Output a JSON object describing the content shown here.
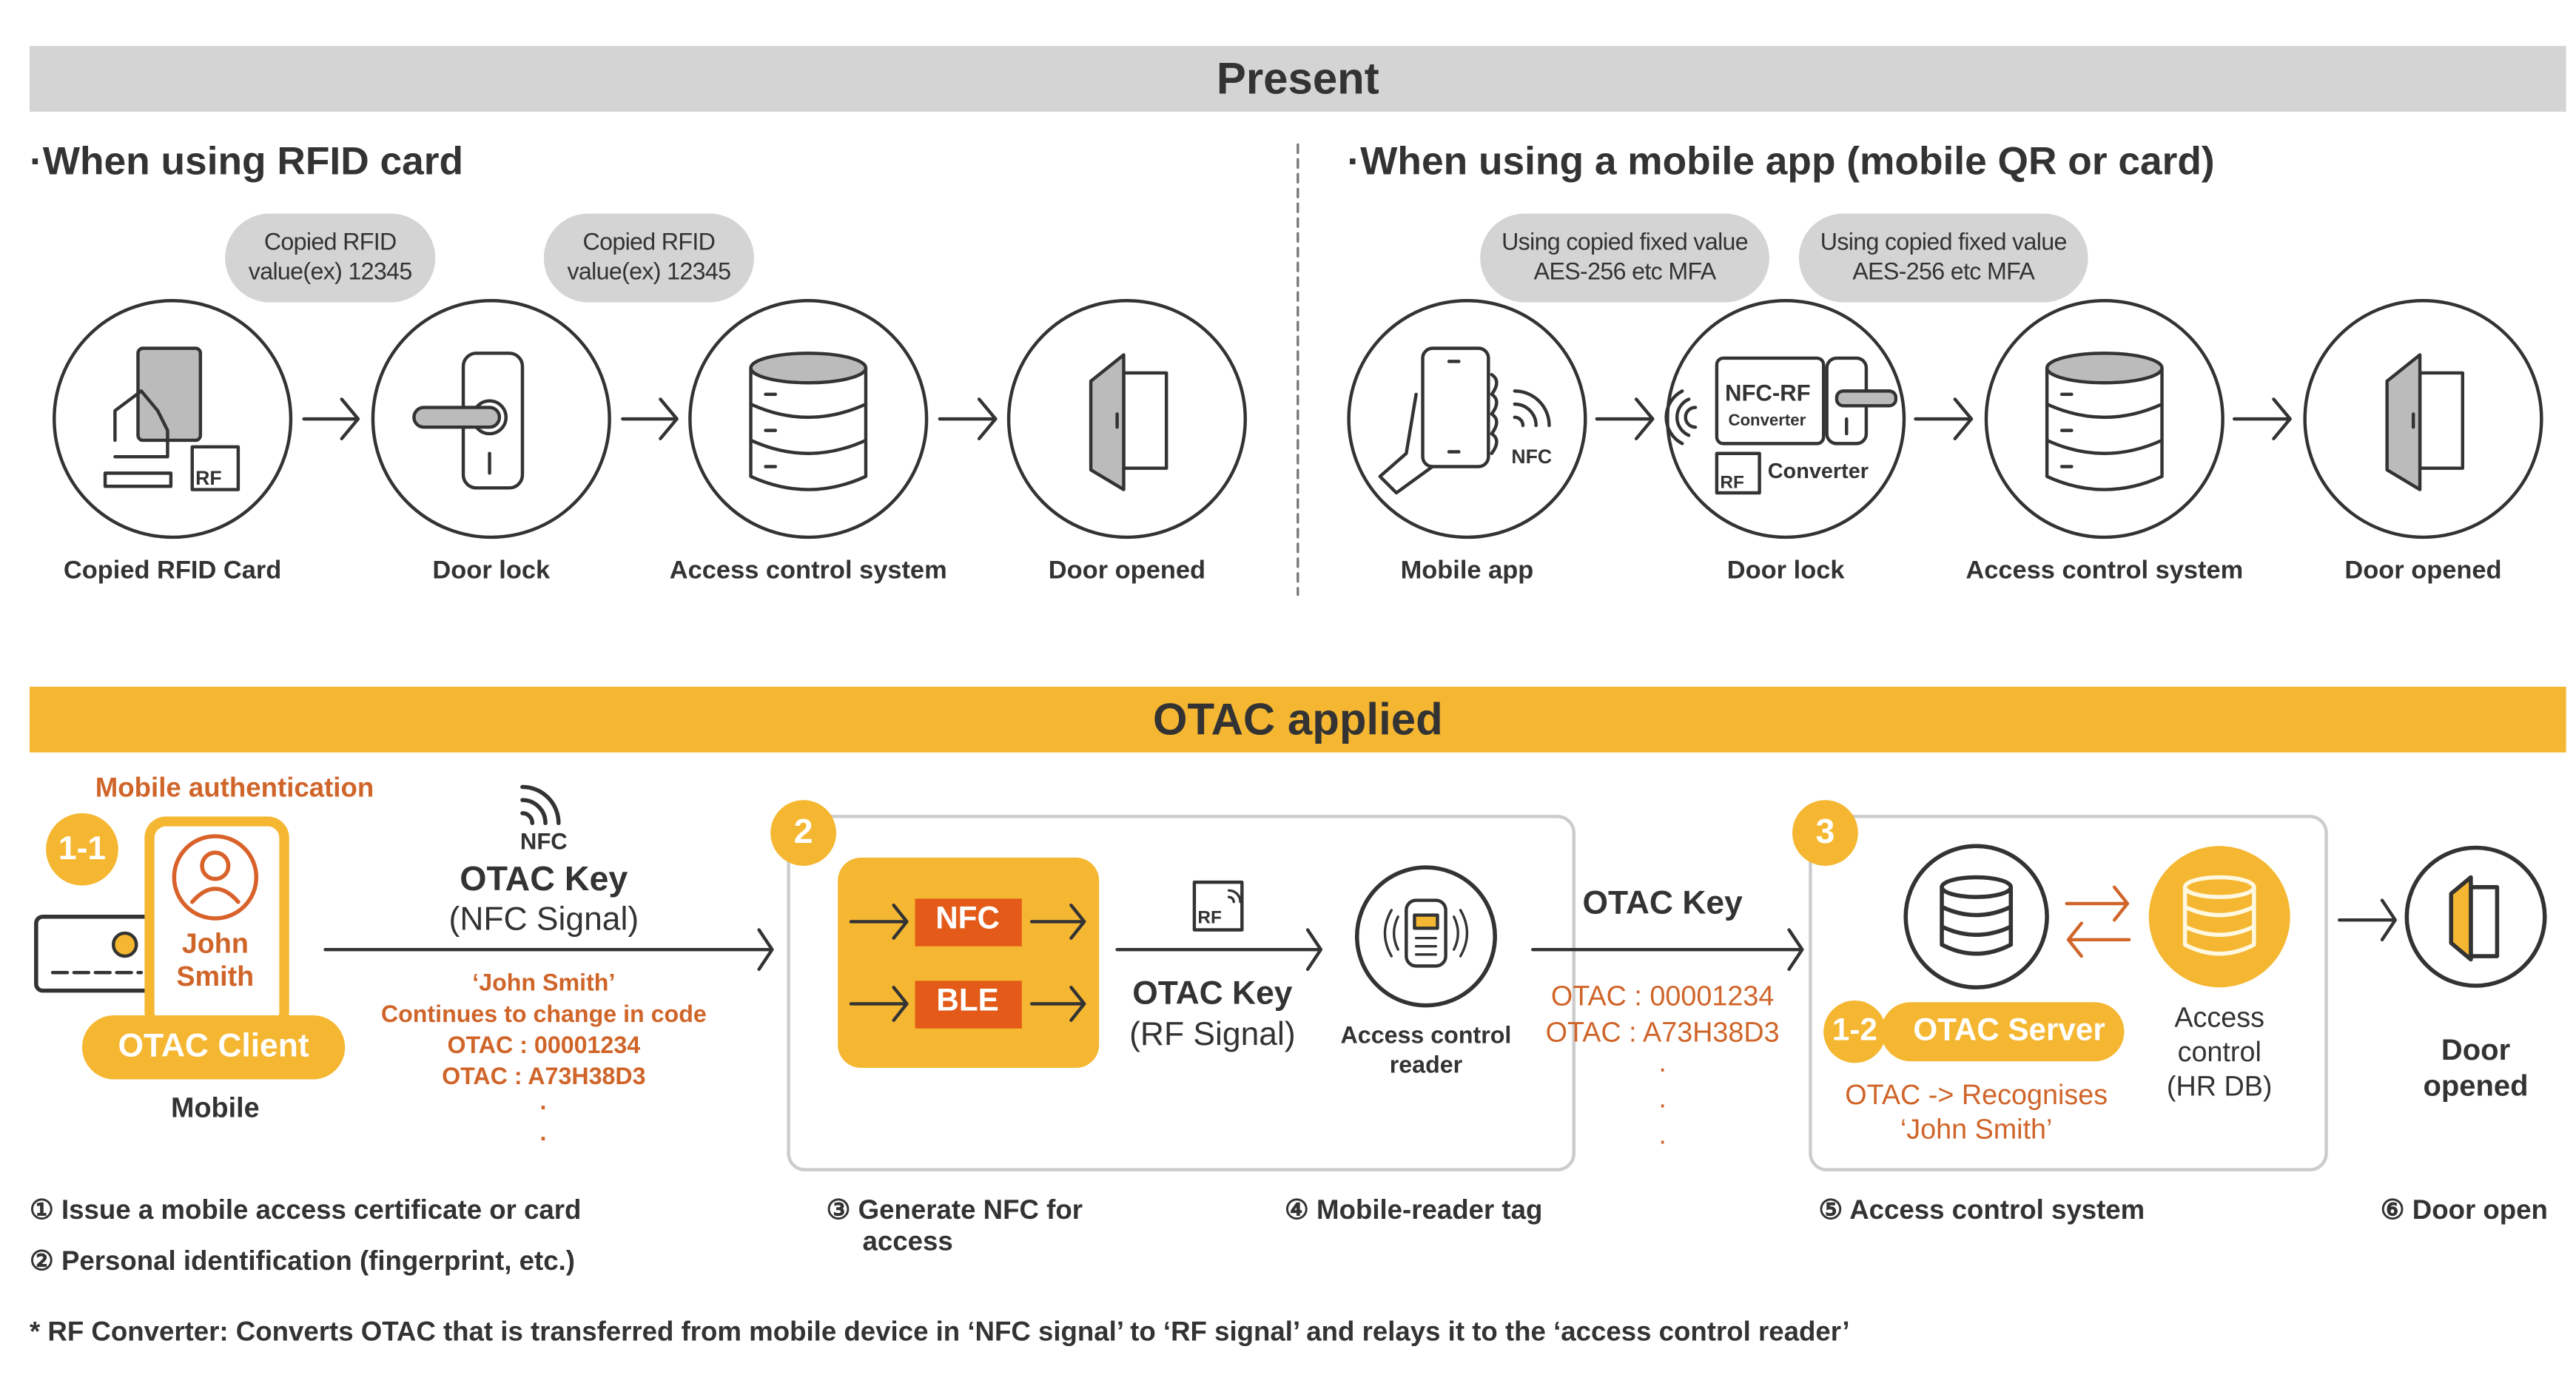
{
  "colors": {
    "accent": "#f5b731",
    "orange_text": "#d0652a",
    "tag_red": "#e35a19",
    "present_bar": "#d4d4d4",
    "ink": "#333333"
  },
  "present": {
    "title": "Present",
    "rfid": {
      "heading": "·When using RFID card",
      "bubbles": [
        "Copied RFID",
        "value(ex) 12345",
        "Copied RFID",
        "value(ex) 12345"
      ],
      "steps": [
        {
          "label": "Copied RFID Card",
          "icon": "rfid-card-hand-icon",
          "tag": "RF"
        },
        {
          "label": "Door lock",
          "icon": "door-lock-icon"
        },
        {
          "label": "Access control system",
          "icon": "database-icon"
        },
        {
          "label": "Door opened",
          "icon": "open-door-icon"
        }
      ]
    },
    "mobile": {
      "heading": "·When using a mobile app (mobile QR or card)",
      "bubbles": [
        "Using copied fixed value",
        "AES-256 etc MFA",
        "Using copied fixed value",
        "AES-256 etc MFA"
      ],
      "steps": [
        {
          "label": "Mobile app",
          "icon": "phone-hand-nfc-icon",
          "tag": "NFC"
        },
        {
          "label": "Door lock",
          "icon": "nfc-rf-converter-lock-icon",
          "tag1": "NFC-RF",
          "tag2": "Converter",
          "rf": "RF",
          "tag3": "Converter"
        },
        {
          "label": "Access control system",
          "icon": "database-icon"
        },
        {
          "label": "Door opened",
          "icon": "open-door-icon"
        }
      ]
    }
  },
  "otac": {
    "title": "OTAC applied",
    "mobile_auth": "Mobile authentication",
    "badge_1_1": "1-1",
    "user_name_1": "John",
    "user_name_2": "Smith",
    "client": "OTAC Client",
    "mobile": "Mobile",
    "nfc_label": "NFC",
    "key1": "OTAC Key",
    "key1_sub": "(NFC Signal)",
    "key1_notes": [
      "‘John Smith’",
      "Continues to change in code",
      "OTAC : 00001234",
      "OTAC : A73H38D3",
      "·",
      "·"
    ],
    "badge_2": "2",
    "nfc_tag": "NFC",
    "ble_tag": "BLE",
    "rf_label": "RF",
    "key2": "OTAC Key",
    "key2_sub": "(RF Signal)",
    "reader_1": "Access control",
    "reader_2": "reader",
    "key3": "OTAC Key",
    "key3_notes": [
      "OTAC : 00001234",
      "OTAC : A73H38D3",
      "·",
      "·",
      "·"
    ],
    "badge_3": "3",
    "badge_1_2": "1-2",
    "server": "OTAC Server",
    "recognise_1": "OTAC -> Recognises",
    "recognise_2": "‘John Smith’",
    "hr_1": "Access",
    "hr_2": "control",
    "hr_3": "(HR DB)",
    "door_1": "Door",
    "door_2": "opened"
  },
  "steps": [
    "① Issue a mobile access certificate or card",
    "② Personal identification (fingerprint, etc.)",
    "③ Generate NFC for",
    "access",
    "④ Mobile-reader tag",
    "⑤ Access control system",
    "⑥ Door open"
  ],
  "footnote": "* RF Converter: Converts OTAC that is transferred from mobile device in ‘NFC signal’ to ‘RF signal’ and relays it to the ‘access control reader’"
}
